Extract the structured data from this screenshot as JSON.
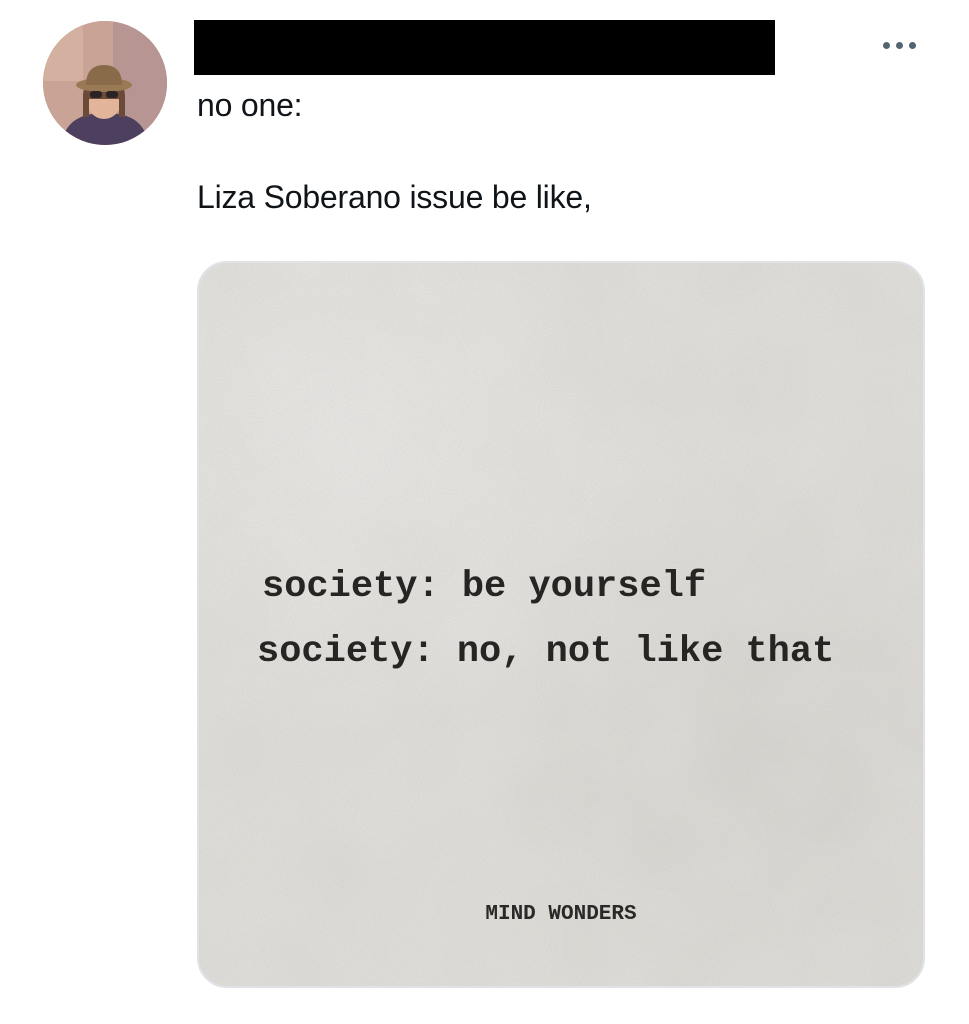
{
  "tweet": {
    "author_avatar_icon": "avatar-photo",
    "author_name_redacted": true,
    "more_icon": "more-horizontal-icon",
    "text_line_1": "no one:",
    "text_line_2": "Liza Soberano issue be like,"
  },
  "media": {
    "quote_line_1": "society: be yourself",
    "quote_line_2": "society: no, not like that",
    "brand": "MIND WONDERS"
  },
  "colors": {
    "text": "#0f1419",
    "secondary": "#536471",
    "paper": "#e1dfda",
    "redaction": "#000000"
  }
}
